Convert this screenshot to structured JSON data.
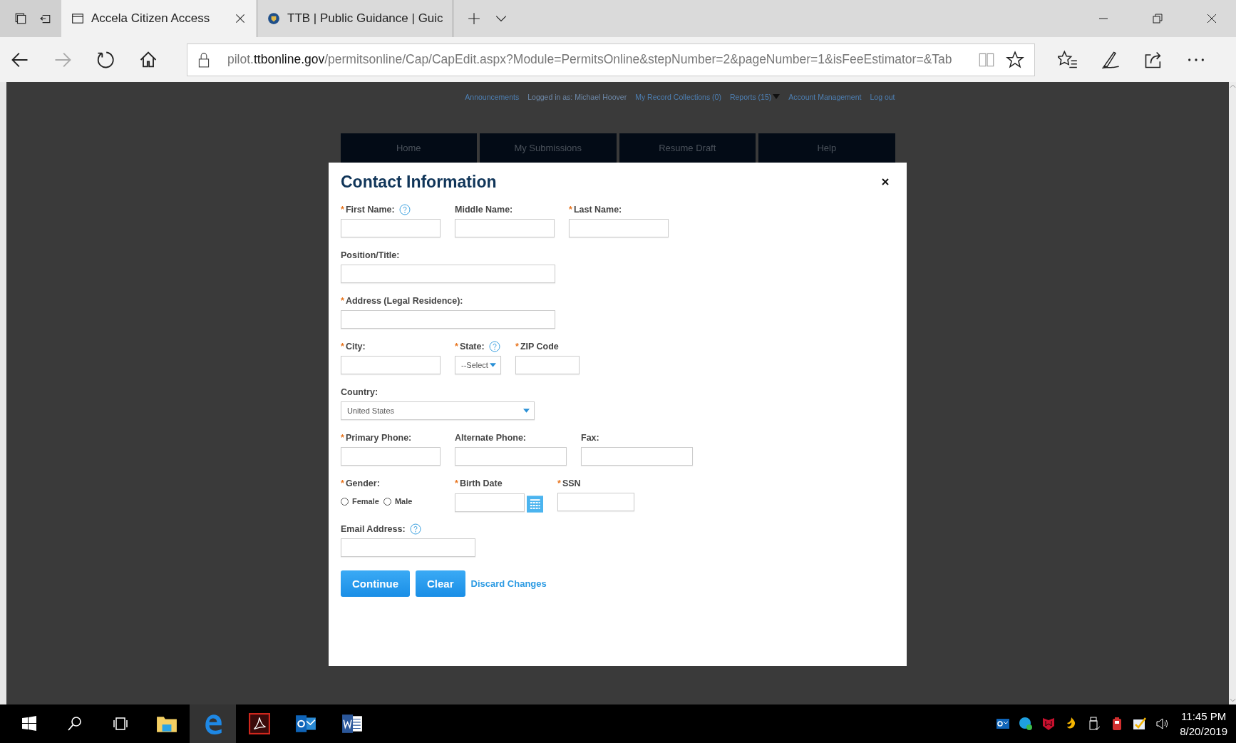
{
  "browser": {
    "tabs": [
      {
        "title": "Accela Citizen Access",
        "selected": true
      },
      {
        "title": "TTB | Public Guidance | Guic",
        "selected": false
      }
    ],
    "address": {
      "prefix": "pilot.",
      "domain": "ttbonline.gov",
      "path": "/permitsonline/Cap/CapEdit.aspx?Module=PermitsOnline&stepNumber=2&pageNumber=1&isFeeEstimator=&Tab"
    },
    "forward_disabled": true
  },
  "header_links": [
    {
      "label": "Announcements",
      "kind": "link"
    },
    {
      "label": "Logged in as: Michael Hoover",
      "kind": "text"
    },
    {
      "label": "My Record Collections (0)",
      "kind": "link"
    },
    {
      "label": "Reports (15)",
      "kind": "menu"
    },
    {
      "label": "Account Management",
      "kind": "link"
    },
    {
      "label": "Log out",
      "kind": "link"
    }
  ],
  "nav": [
    "Home",
    "My Submissions",
    "Resume Draft",
    "Help"
  ],
  "dialog": {
    "title": "Contact Information",
    "rows": [
      [
        {
          "kind": "text",
          "label": "First Name:",
          "required_mark": "*",
          "help": true
        },
        {
          "kind": "text",
          "label": "Middle Name:",
          "help": false
        },
        {
          "kind": "text",
          "label": "Last Name:",
          "required_mark": "*",
          "help": false
        }
      ],
      [
        {
          "kind": "text",
          "label": "Position/Title:",
          "help": false
        }
      ],
      [
        {
          "kind": "text",
          "label": "Address (Legal Residence):",
          "required_mark": "*",
          "help": false
        }
      ],
      [
        {
          "kind": "text",
          "label": "City:",
          "required_mark": "*",
          "help": false
        },
        {
          "kind": "select",
          "label": "State:",
          "required_mark": "*",
          "help": true,
          "value": "--Select"
        },
        {
          "kind": "text",
          "label": "ZIP Code",
          "required_mark": "*",
          "help": false
        }
      ],
      [
        {
          "kind": "select",
          "label": "Country:",
          "help": false,
          "value": "United States"
        }
      ],
      [
        {
          "kind": "text",
          "label": "Primary Phone:",
          "required_mark": "*",
          "help": false
        },
        {
          "kind": "text",
          "label": "Alternate Phone:",
          "help": false
        },
        {
          "kind": "text",
          "label": "Fax:",
          "help": false
        }
      ],
      [
        {
          "kind": "radio",
          "label": "Gender:",
          "required_mark": "*",
          "help": false,
          "options": [
            {
              "label": "Female",
              "selected": false
            },
            {
              "label": "Male",
              "selected": false
            }
          ]
        },
        {
          "kind": "date",
          "label": "Birth Date",
          "required_mark": "*",
          "help": false
        },
        {
          "kind": "text",
          "label": "SSN",
          "required_mark": "*",
          "help": false
        }
      ],
      [
        {
          "kind": "text",
          "label": "Email Address:",
          "help": true
        }
      ]
    ],
    "buttons": [
      {
        "label": "Continue",
        "kind": "button"
      },
      {
        "label": "Clear",
        "kind": "button"
      },
      {
        "label": "Discard Changes",
        "kind": "link"
      }
    ]
  },
  "taskbar": {
    "apps": [
      {
        "kind": "explorer",
        "selected": false
      },
      {
        "kind": "edge",
        "selected": true
      },
      {
        "kind": "acrobat",
        "selected": false
      },
      {
        "kind": "outlook",
        "selected": false
      },
      {
        "kind": "word",
        "selected": false
      }
    ],
    "clock": {
      "time": "11:45 PM",
      "date": "8/20/2019"
    }
  }
}
